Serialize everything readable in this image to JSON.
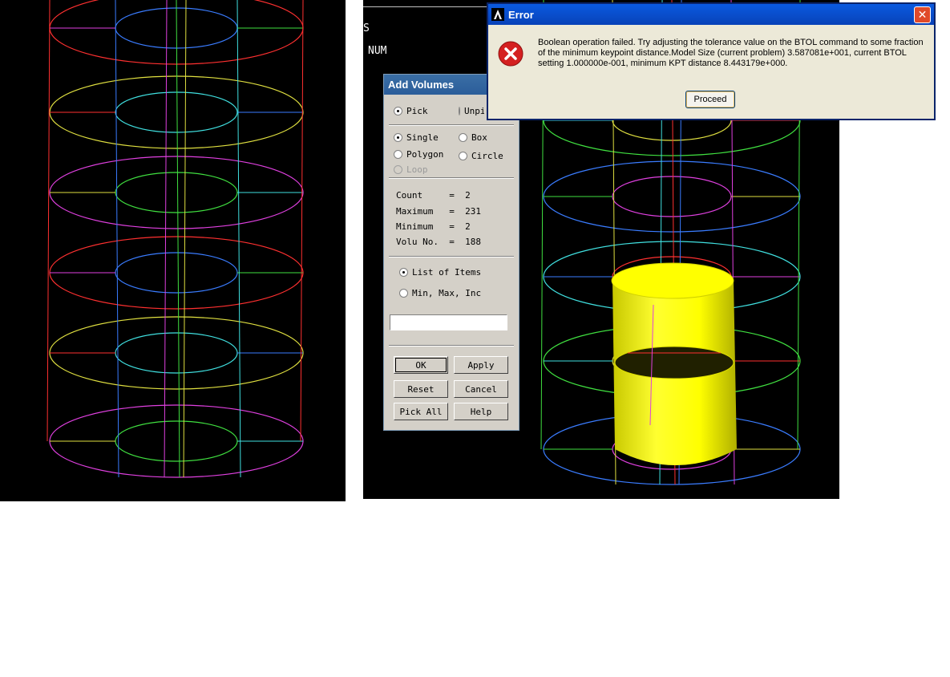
{
  "graphics": {
    "label_s": "S",
    "label_num": "NUM"
  },
  "picker": {
    "title": "Add Volumes",
    "mode_pick": "Pick",
    "mode_unpick": "Unpick",
    "shape_single": "Single",
    "shape_box": "Box",
    "shape_polygon": "Polygon",
    "shape_circle": "Circle",
    "shape_loop": "Loop",
    "stats": [
      {
        "label": "Count     =",
        "value": "2"
      },
      {
        "label": "Maximum   =",
        "value": "231"
      },
      {
        "label": "Minimum   =",
        "value": "2"
      },
      {
        "label": "Volu No.  =",
        "value": "188"
      }
    ],
    "list_items": "List of Items",
    "min_max_inc": "Min, Max, Inc",
    "input_value": "",
    "buttons": {
      "ok": "OK",
      "apply": "Apply",
      "reset": "Reset",
      "cancel": "Cancel",
      "pick_all": "Pick All",
      "help": "Help"
    }
  },
  "error_dialog": {
    "title": "Error",
    "message": "Boolean operation failed.  Try adjusting the tolerance value on the BTOL command to some fraction of the minimum keypoint distance.Model Size (current problem) 3.587081e+001, current BTOL setting 1.000000e-001, minimum KPT distance 8.443179e+000.",
    "proceed_label": "Proceed",
    "icon": "error-icon"
  },
  "colors": {
    "viewport_bg": "#000000",
    "wire_red": "#ff3030",
    "wire_blue": "#3a7cff",
    "wire_magenta": "#e040e0",
    "wire_green": "#40e040",
    "wire_yellow": "#e0e040",
    "wire_cyan": "#40e0e0",
    "highlight_volume": "#ffff00"
  }
}
